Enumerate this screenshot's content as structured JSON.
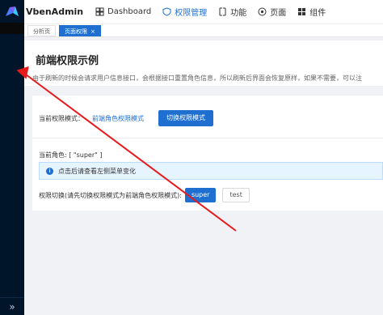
{
  "app": {
    "brand": "VbenAdmin"
  },
  "header": {
    "nav": [
      {
        "label": "Dashboard",
        "icon": "dashboard-icon",
        "active": false
      },
      {
        "label": "权限管理",
        "icon": "shield-icon",
        "active": true
      },
      {
        "label": "功能",
        "icon": "function-icon",
        "active": false
      },
      {
        "label": "页面",
        "icon": "page-icon",
        "active": false
      },
      {
        "label": "组件",
        "icon": "component-icon",
        "active": false
      }
    ]
  },
  "tabs": [
    {
      "label": "分析页",
      "active": false
    },
    {
      "label": "页面权限",
      "active": true,
      "close": "×"
    }
  ],
  "page": {
    "title": "前端权限示例",
    "description": "由于刷新的时候会请求用户信息接口，会根据接口重置角色信息，所以刷新后界面会恢复原样，如果不需要，可以注"
  },
  "main": {
    "mode_label": "当前权限模式：",
    "mode_value": "前端角色权限模式",
    "switch_button": "切换权限模式",
    "current_role": "当前角色: [ \"super\" ]",
    "alert_text": "点击后请查看左侧菜单变化",
    "switch_label": "权限切换(请先切换权限模式为前端角色权限模式):",
    "buttons": {
      "super": "super",
      "test": "test"
    }
  },
  "sidebar": {
    "collapse_glyph": "»"
  },
  "colors": {
    "primary": "#1f6fd0",
    "sidebar": "#001529",
    "arrow": "#e8191b"
  }
}
